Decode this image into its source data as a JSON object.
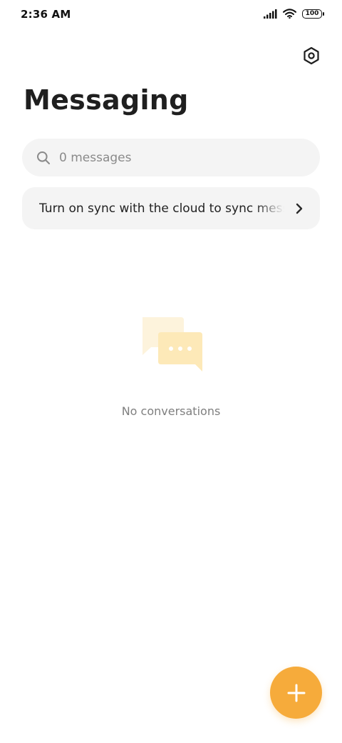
{
  "status_bar": {
    "time": "2:36 AM",
    "battery_level": "100"
  },
  "header": {
    "title": "Messaging"
  },
  "search": {
    "placeholder": "0 messages"
  },
  "sync_banner": {
    "text": "Turn on sync with the cloud to sync messages"
  },
  "empty_state": {
    "text": "No conversations"
  },
  "icons": {
    "settings": "settings-hexagon-icon",
    "search": "search-icon",
    "chevron": "chevron-right-icon",
    "fab": "plus-icon",
    "illustration": "chat-bubbles-icon"
  },
  "colors": {
    "accent": "#f6ab3b",
    "surface": "#f4f4f4",
    "illustration_back": "#fdf3dc",
    "illustration_front": "#fde9b8"
  }
}
